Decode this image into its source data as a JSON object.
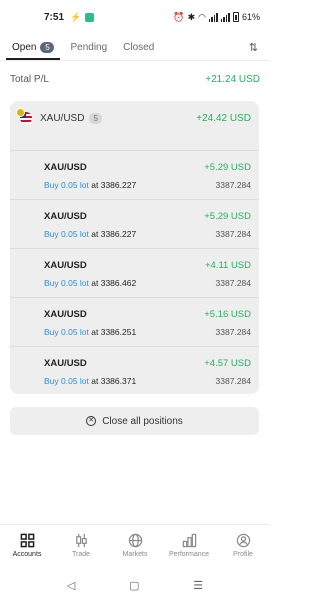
{
  "status": {
    "time": "7:51",
    "battery": "61%"
  },
  "tabs": [
    {
      "label": "Open",
      "count": "5"
    },
    {
      "label": "Pending"
    },
    {
      "label": "Closed"
    }
  ],
  "total": {
    "label": "Total P/L",
    "value": "+21.24 USD"
  },
  "group": {
    "symbol": "XAU/USD",
    "count": "5",
    "value": "+24.42 USD"
  },
  "positions": [
    {
      "symbol": "XAU/USD",
      "action": "Buy 0.05 lot",
      "open_text": "at 3386.227",
      "pl": "+5.29 USD",
      "current": "3387.284"
    },
    {
      "symbol": "XAU/USD",
      "action": "Buy 0.05 lot",
      "open_text": "at 3386.227",
      "pl": "+5.29 USD",
      "current": "3387.284"
    },
    {
      "symbol": "XAU/USD",
      "action": "Buy 0.05 lot",
      "open_text": "at 3386.462",
      "pl": "+4.11 USD",
      "current": "3387.284"
    },
    {
      "symbol": "XAU/USD",
      "action": "Buy 0.05 lot",
      "open_text": "at 3386.251",
      "pl": "+5.16 USD",
      "current": "3387.284"
    },
    {
      "symbol": "XAU/USD",
      "action": "Buy 0.05 lot",
      "open_text": "at 3386.371",
      "pl": "+4.57 USD",
      "current": "3387.284"
    }
  ],
  "close_all": {
    "label": "Close all positions"
  },
  "nav": [
    {
      "label": "Accounts",
      "icon": "accounts-grid-icon"
    },
    {
      "label": "Trade",
      "icon": "trade-candles-icon"
    },
    {
      "label": "Markets",
      "icon": "globe-icon"
    },
    {
      "label": "Performance",
      "icon": "bar-chart-icon"
    },
    {
      "label": "Profile",
      "icon": "user-icon"
    }
  ],
  "colors": {
    "profit": "#22b35e",
    "action": "#2d8fd5"
  }
}
